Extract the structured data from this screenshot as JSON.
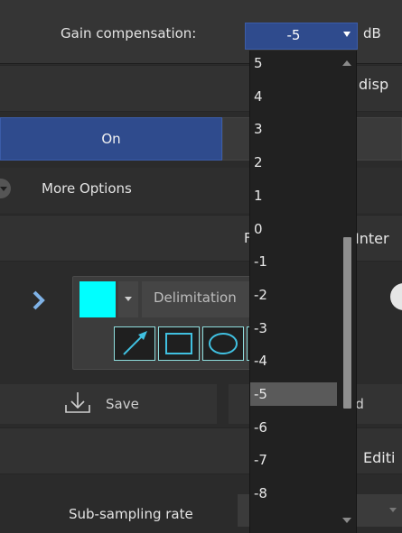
{
  "gain": {
    "label": "Gain compensation:",
    "selected": "-5",
    "unit": "dB",
    "options": [
      "5",
      "4",
      "3",
      "2",
      "1",
      "0",
      "-1",
      "-2",
      "-3",
      "-4",
      "-5",
      "-6",
      "-7",
      "-8"
    ],
    "selected_index": 10,
    "accent_color": "#2f4b8d"
  },
  "sections": {
    "header1_right": "disp",
    "header2_fragment": "F",
    "header2_right": "Inter",
    "header3_right": "Editi"
  },
  "toggle": {
    "on_label": "On"
  },
  "more": {
    "label": "More Options"
  },
  "tools": {
    "color": "#00ffff",
    "delimitation_label": "Delimitation",
    "icons": [
      "arrow-icon",
      "rectangle-icon",
      "ellipse-icon"
    ]
  },
  "actions": {
    "save_label": "Save",
    "load_fragment": "oad"
  },
  "subsampling": {
    "label": "Sub-sampling rate"
  }
}
